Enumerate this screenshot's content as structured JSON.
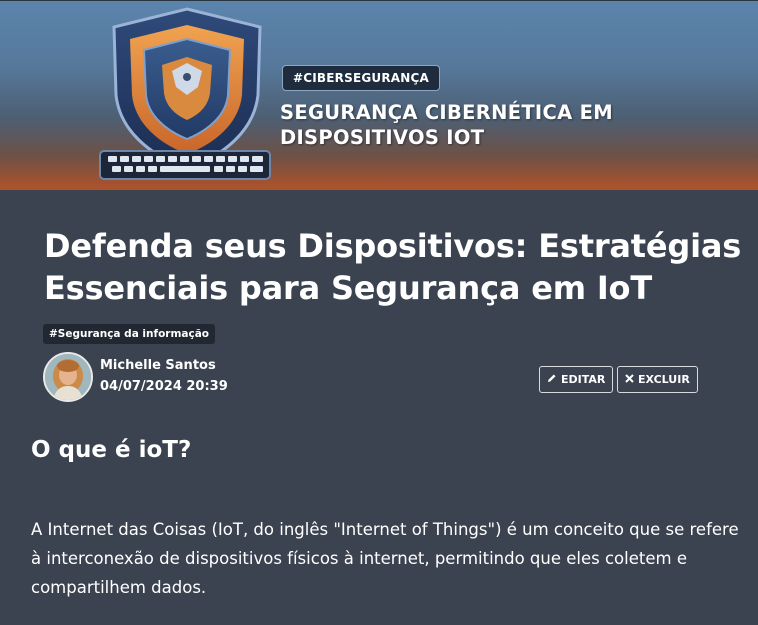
{
  "banner": {
    "tag": "#CIBERSEGURANÇA",
    "title": "SEGURANÇA CIBERNÉTICA EM DISPOSITIVOS IOT",
    "illustration": "shield-keyboard-icon"
  },
  "article": {
    "title": "Defenda seus Dispositivos: Estratégias Essenciais para Segurança em IoT",
    "category": "#Segurança da informação",
    "author": "Michelle Santos",
    "date": "04/07/2024 20:39",
    "section_title": "O que é ioT?",
    "paragraph": "A Internet das Coisas (IoT, do inglês \"Internet of Things\") é um conceito que se refere à interconexão de dispositivos físicos à internet, permitindo que eles coletem e compartilhem dados."
  },
  "actions": {
    "edit_label": "EDITAR",
    "edit_icon": "pencil-icon",
    "delete_label": "EXCLUIR",
    "delete_icon": "close-icon"
  },
  "colors": {
    "page_background": "#3b4350",
    "tag_background": "#222831",
    "button_border": "#d7dbe0"
  }
}
